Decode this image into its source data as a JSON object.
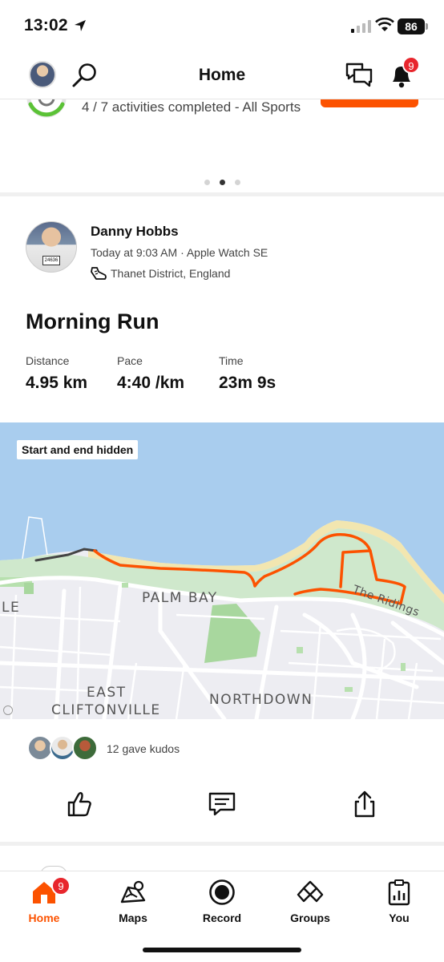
{
  "status_bar": {
    "time": "13:02",
    "battery": "86"
  },
  "header": {
    "title": "Home",
    "notification_count": "9"
  },
  "challenge": {
    "progress_text": "4 / 7 activities completed - All Sports"
  },
  "activity": {
    "athlete_name": "Danny Hobbs",
    "meta": "Today at 9:03 AM · Apple Watch SE",
    "location": "Thanet District, England",
    "title": "Morning Run",
    "bib_number": "24636",
    "stats": [
      {
        "label": "Distance",
        "value": "4.95 km"
      },
      {
        "label": "Pace",
        "value": "4:40 /km"
      },
      {
        "label": "Time",
        "value": "23m 9s"
      }
    ],
    "map": {
      "privacy_badge": "Start and end hidden",
      "labels": [
        "PALM BAY",
        "EAST",
        "CLIFTONVILLE",
        "NORTHDOWN",
        "LE",
        "The Ridings"
      ],
      "route_color": "#fc5200",
      "water_color": "#a9cdee",
      "park_color": "#cfe8cc"
    },
    "kudos_text": "12 gave kudos"
  },
  "tab_bar": {
    "tabs": [
      {
        "label": "Home",
        "icon": "home-icon",
        "active": true
      },
      {
        "label": "Maps",
        "icon": "maps-icon"
      },
      {
        "label": "Record",
        "icon": "record-icon"
      },
      {
        "label": "Groups",
        "icon": "groups-icon"
      },
      {
        "label": "You",
        "icon": "you-icon"
      }
    ],
    "home_badge": "9"
  },
  "colors": {
    "accent": "#fc5200",
    "badge": "#e8262d"
  }
}
